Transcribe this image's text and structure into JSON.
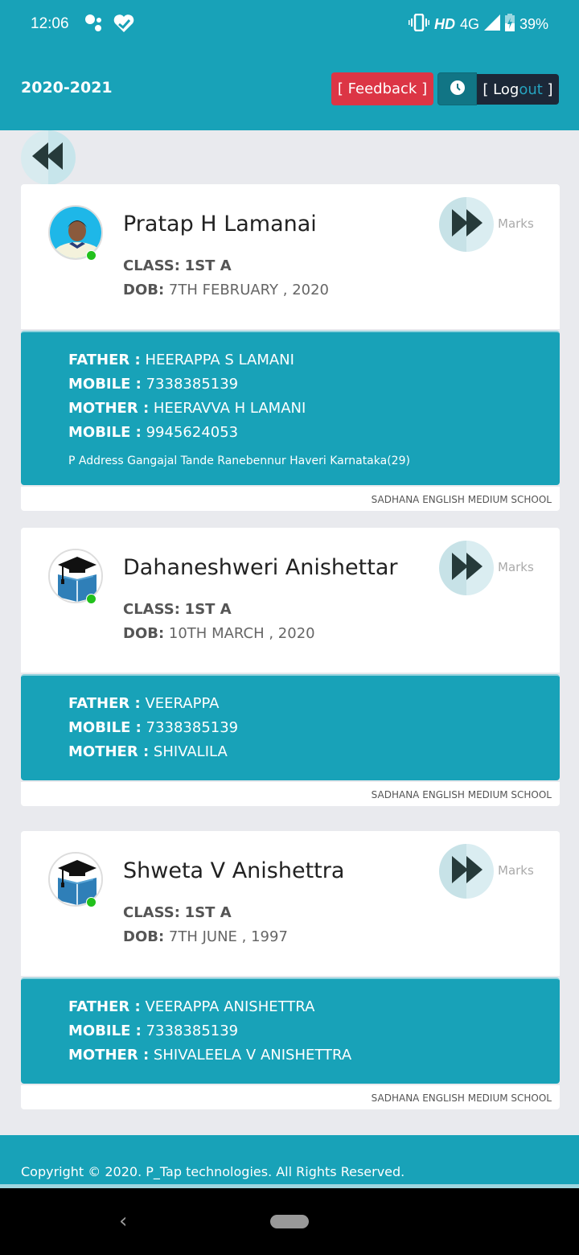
{
  "status_bar": {
    "time": "12:06",
    "left_icons": [
      "assistant-icon",
      "health-heart-icon"
    ],
    "network_hd": "HD",
    "network_type": "4G",
    "battery": "39%"
  },
  "header": {
    "academic_year": "2020-2021",
    "feedback_label": "[ Feedback ]",
    "logout_prefix": "[ Log",
    "logout_suffix": "out",
    "logout_end": " ]",
    "accent": "#18a2b8",
    "feedback_color": "#dc3545",
    "logout_bg": "#1c2838"
  },
  "marks_label": "Marks",
  "labels": {
    "class": "CLASS:",
    "dob": "DOB:",
    "father": "FATHER :",
    "mobile": "MOBILE :",
    "mother": "MOTHER :"
  },
  "students": [
    {
      "name": "Pratap H Lamanai",
      "avatar": "student-photo",
      "class": "1ST A",
      "dob": "7TH FEBRUARY , 2020",
      "father": "HEERAPPA S LAMANI",
      "father_mobile": "7338385139",
      "mother": "HEERAVVA H LAMANI",
      "mother_mobile": "9945624053",
      "address": "P Address Gangajal Tande Ranebennur Haveri Karnataka(29)",
      "school": "SADHANA ENGLISH MEDIUM SCHOOL"
    },
    {
      "name": "Dahaneshweri Anishettar",
      "avatar": "graduation-book-icon",
      "class": "1ST A",
      "dob": "10TH MARCH , 2020",
      "father": "VEERAPPA",
      "father_mobile": "7338385139",
      "mother": "SHIVALILA",
      "school": "SADHANA ENGLISH MEDIUM SCHOOL"
    },
    {
      "name": "Shweta V Anishettra",
      "avatar": "graduation-book-icon",
      "class": "1ST A",
      "dob": "7TH JUNE , 1997",
      "father": "VEERAPPA ANISHETTRA",
      "father_mobile": "7338385139",
      "mother": "SHIVALEELA V ANISHETTRA",
      "school": "SADHANA ENGLISH MEDIUM SCHOOL"
    }
  ],
  "footer": {
    "copyright": "Copyright © 2020. P_Tap technologies. All Rights Reserved."
  },
  "nav_bar": {
    "back_glyph": "‹"
  }
}
